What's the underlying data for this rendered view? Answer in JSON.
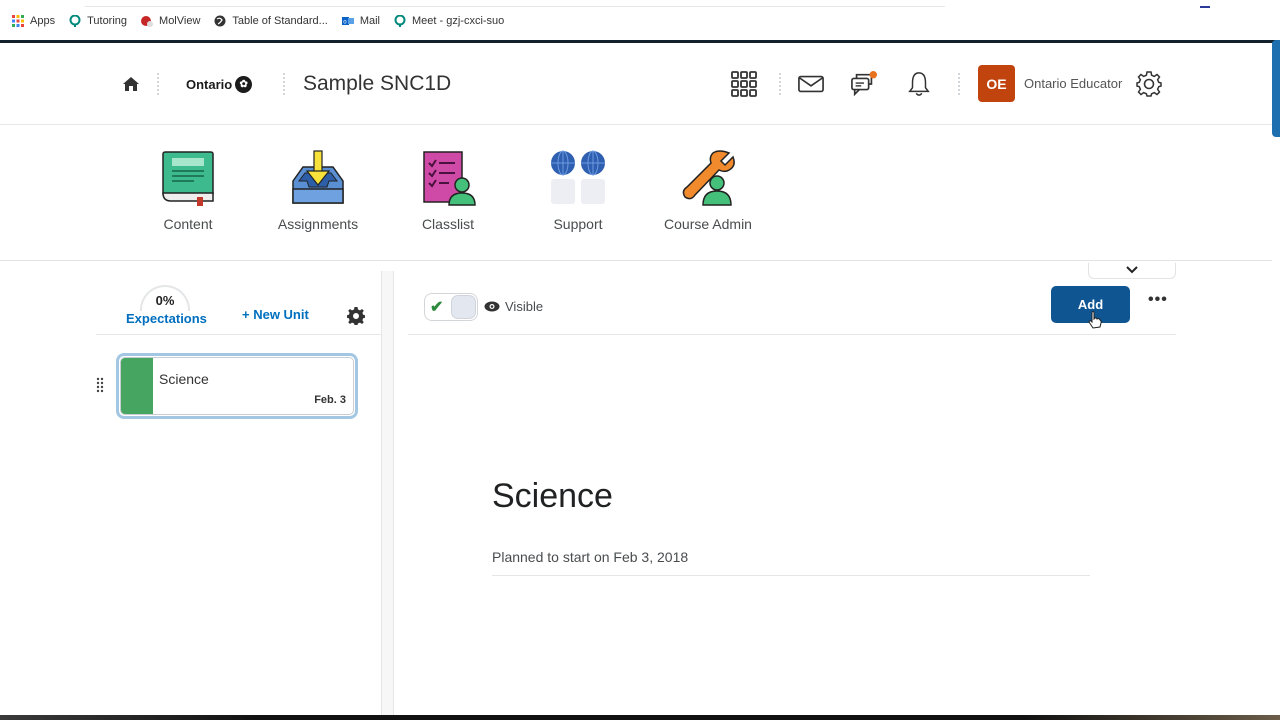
{
  "bookmarks": [
    {
      "label": "Apps",
      "icon": "apps-grid-icon"
    },
    {
      "label": "Tutoring",
      "icon": "meet-icon"
    },
    {
      "label": "MolView",
      "icon": "molview-icon"
    },
    {
      "label": "Table of Standard...",
      "icon": "globe-icon"
    },
    {
      "label": "Mail",
      "icon": "outlook-icon"
    },
    {
      "label": "Meet - gzj-cxci-suo",
      "icon": "meet-icon"
    }
  ],
  "header": {
    "org": "Ontario",
    "course_title": "Sample SNC1D",
    "avatar_initials": "OE",
    "user_name": "Ontario Educator",
    "colors": {
      "avatar": "#c1440e",
      "notification_dot": "#e8731e"
    }
  },
  "nav": {
    "items": [
      {
        "label": "Content",
        "icon": "book-icon"
      },
      {
        "label": "Assignments",
        "icon": "inbox-download-icon"
      },
      {
        "label": "Classlist",
        "icon": "classlist-icon"
      },
      {
        "label": "Support",
        "icon": "support-globes-icon"
      },
      {
        "label": "Course Admin",
        "icon": "wrench-user-icon"
      }
    ]
  },
  "left_panel": {
    "expectations_percent": "0%",
    "expectations_label": "Expectations",
    "new_unit_label": "+ New Unit",
    "units": [
      {
        "name": "Science",
        "date": "Feb. 3",
        "color": "#46a661"
      }
    ]
  },
  "right_panel": {
    "visibility_label": "Visible",
    "visible": true,
    "add_label": "Add",
    "more_label": "•••",
    "dropdown_chevron": "⌵",
    "unit_title": "Science",
    "planned_text": "Planned to start on Feb 3, 2018",
    "colors": {
      "add_button": "#0f5592",
      "link": "#006fbf"
    }
  }
}
